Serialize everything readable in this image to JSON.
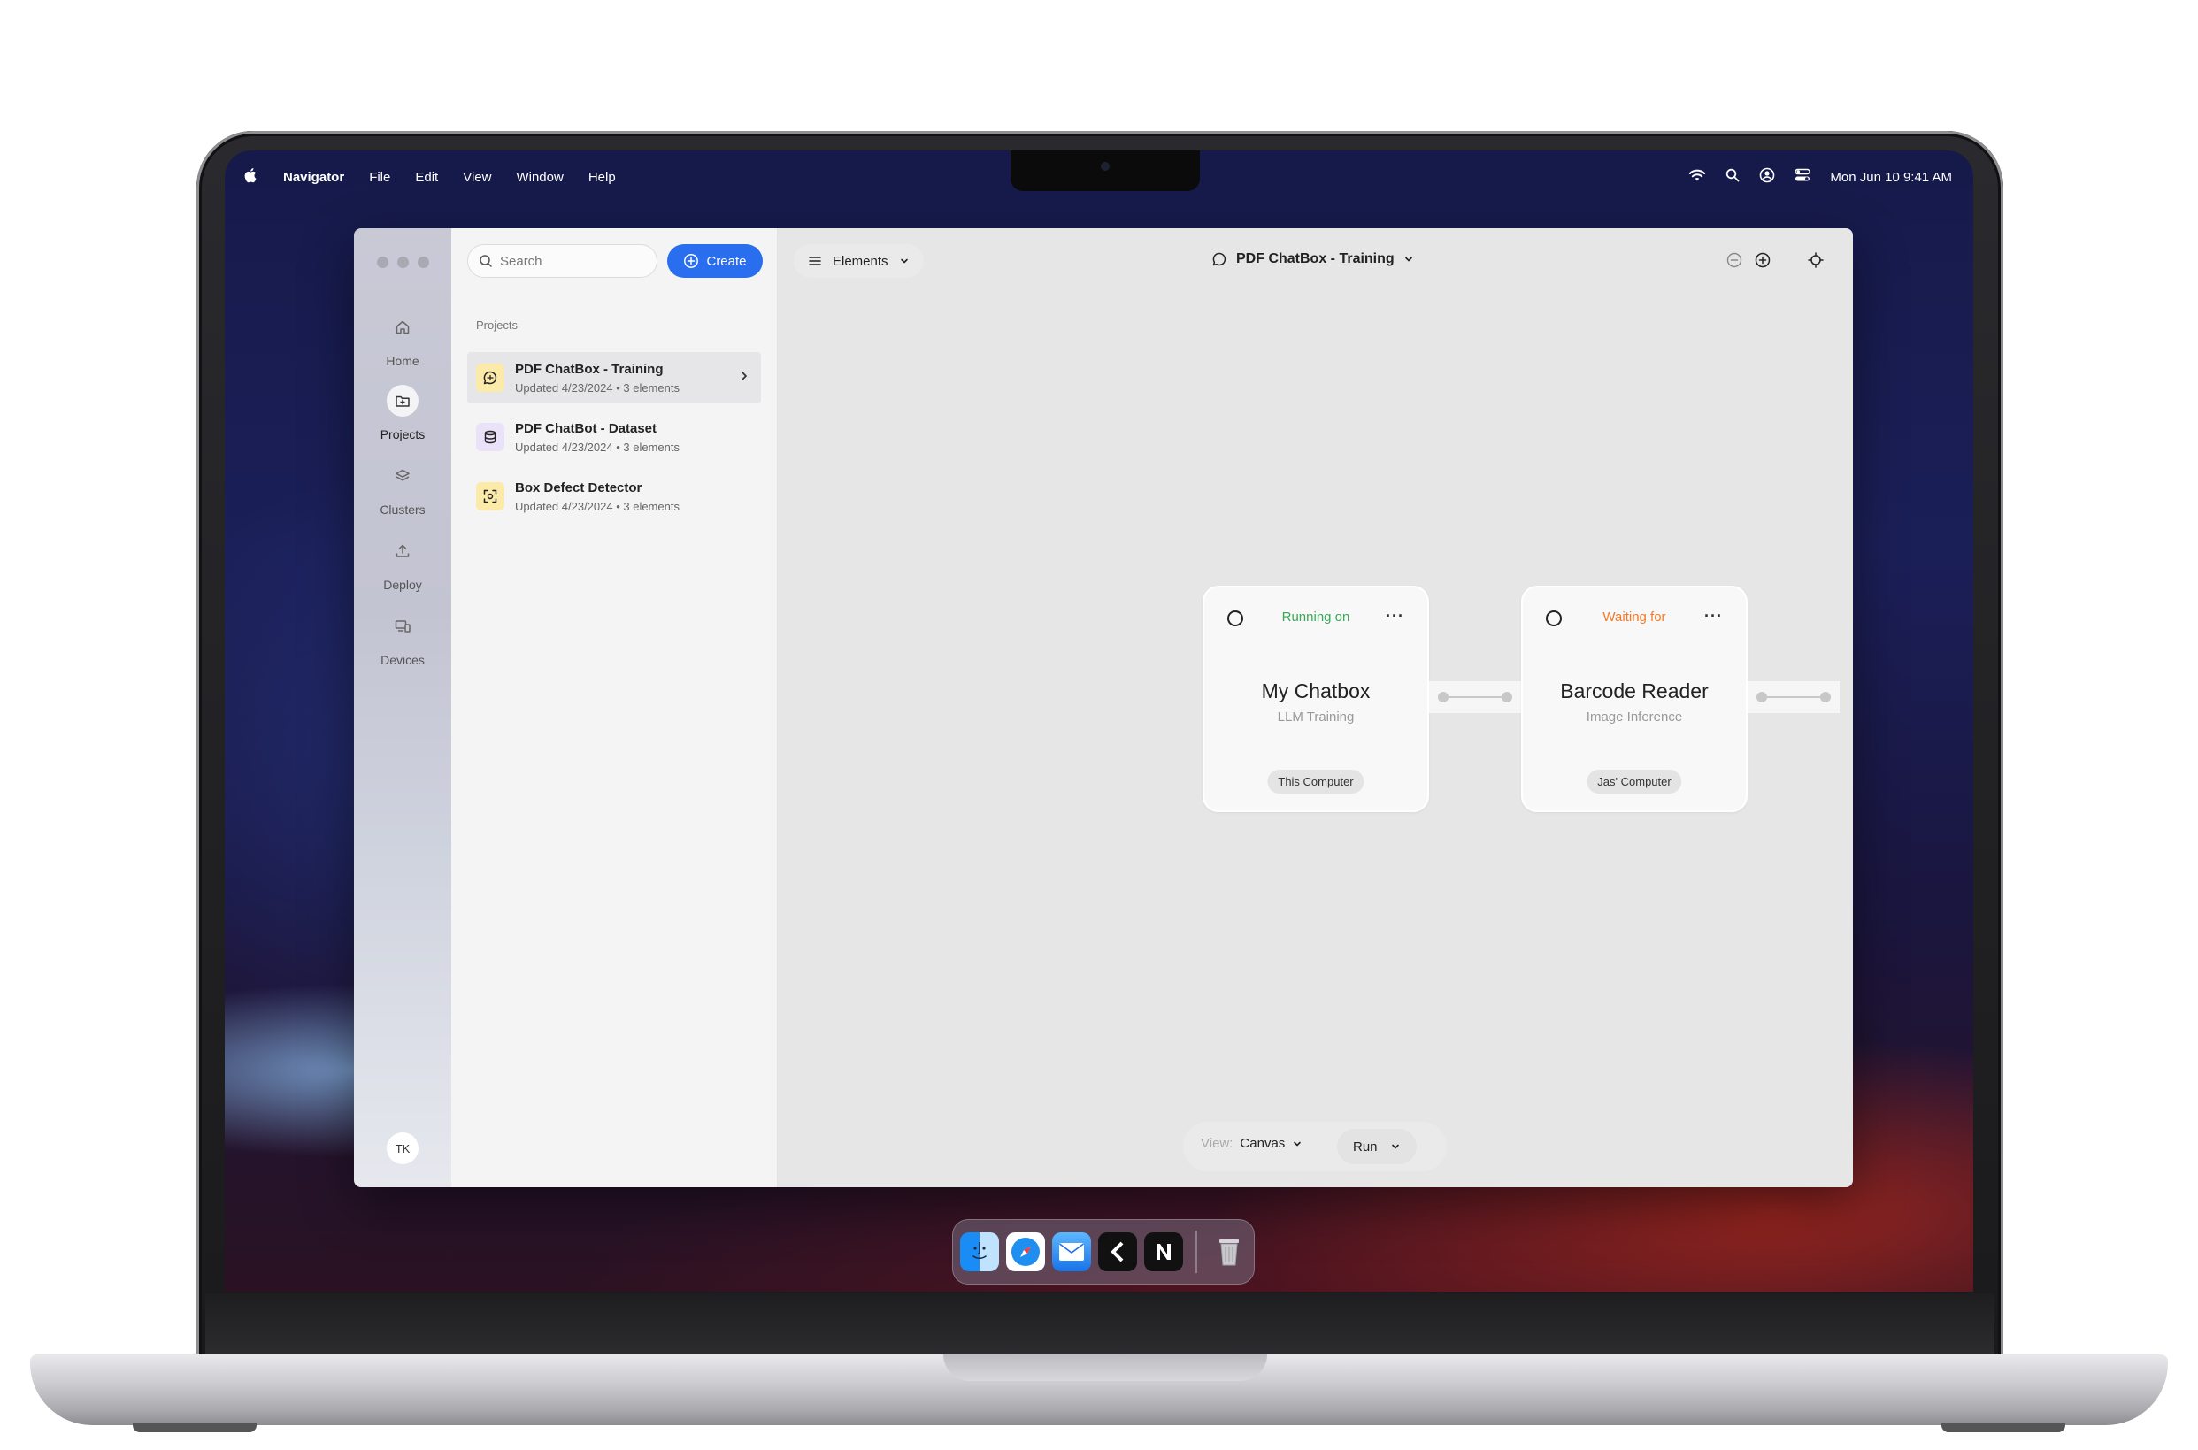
{
  "menubar": {
    "app_name": "Navigator",
    "menus": [
      "File",
      "Edit",
      "View",
      "Window",
      "Help"
    ],
    "datetime": "Mon Jun 10  9:41 AM"
  },
  "rail": {
    "items": [
      {
        "label": "Home",
        "icon": "home-icon"
      },
      {
        "label": "Projects",
        "icon": "folder-icon",
        "active": true
      },
      {
        "label": "Clusters",
        "icon": "layers-icon"
      },
      {
        "label": "Deploy",
        "icon": "upload-icon"
      },
      {
        "label": "Devices",
        "icon": "devices-icon"
      }
    ],
    "avatar": "TK"
  },
  "sidebar": {
    "search_placeholder": "Search",
    "create_label": "Create",
    "section_label": "Projects",
    "projects": [
      {
        "name": "PDF ChatBox - Training",
        "meta": "Updated 4/23/2024 • 3 elements",
        "icon": "chat-icon",
        "icon_bg": "#fbeaa8"
      },
      {
        "name": "PDF ChatBot - Dataset",
        "meta": "Updated 4/23/2024 • 3 elements",
        "icon": "database-icon",
        "icon_bg": "#e9e2f8"
      },
      {
        "name": "Box Defect Detector",
        "meta": "Updated 4/23/2024 • 3 elements",
        "icon": "scan-icon",
        "icon_bg": "#fbeaa8"
      }
    ]
  },
  "canvas": {
    "elements_label": "Elements",
    "title": "PDF ChatBox - Training",
    "nodes": [
      {
        "status": "Running on",
        "status_color": "#3aa757",
        "title": "My Chatbox",
        "subtitle": "LLM Training",
        "chip": "This Computer"
      },
      {
        "status": "Waiting for",
        "status_color": "#f07a2a",
        "title": "Barcode Reader",
        "subtitle": "Image Inference",
        "chip": "Jas' Computer"
      }
    ],
    "view_key": "View:",
    "view_value": "Canvas",
    "run_label": "Run"
  },
  "colors": {
    "accent": "#2a6ef0",
    "running": "#3aa757",
    "waiting": "#f07a2a"
  },
  "dock": [
    "finder-icon",
    "safari-icon",
    "mail-icon",
    "kx-app-icon",
    "n-app-icon",
    "trash-icon"
  ]
}
